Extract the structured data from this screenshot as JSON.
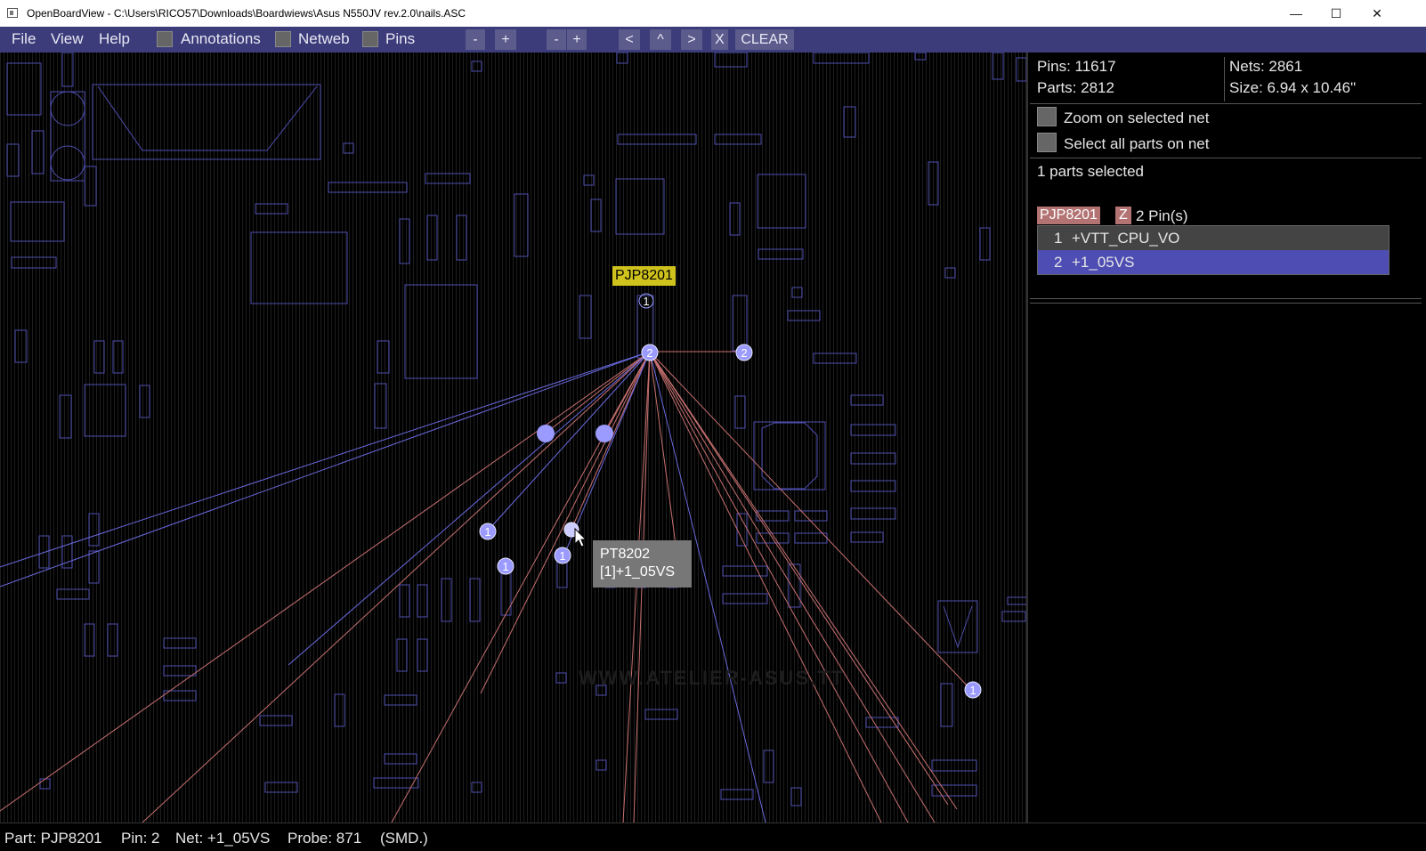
{
  "window": {
    "title": "OpenBoardView - C:\\Users\\RICO57\\Downloads\\Boardwiews\\Asus N550JV rev.2.0\\nails.ASC",
    "minimize": "—",
    "maximize": "☐",
    "close": "✕"
  },
  "menu": {
    "file": "File",
    "view": "View",
    "help": "Help",
    "annotations": "Annotations",
    "netweb": "Netweb",
    "pins": "Pins"
  },
  "toolbar": {
    "zoom_out_1": "-",
    "zoom_in_1": "+",
    "zoom_out_2": "-",
    "zoom_in_2": "+",
    "prev": "<",
    "up": "^",
    "next": ">",
    "close_x": "X",
    "clear": "CLEAR"
  },
  "board": {
    "part_label": "PJP8201",
    "tooltip_part": "PT8202",
    "tooltip_net": "[1]+1_05VS",
    "watermark": "WWW.ATELIER-ASUS.TT",
    "pin_labels": [
      "1",
      "2",
      "2",
      "1",
      "1",
      "1",
      "1"
    ]
  },
  "panel": {
    "pins": "Pins: 11617",
    "parts": "Parts: 2812",
    "nets": "Nets: 2861",
    "size": "Size: 6.94 x 10.46\"",
    "zoom_on_net": "Zoom on selected net",
    "select_all_parts": "Select all parts on net",
    "parts_selected": "1 parts selected",
    "selected_part": "PJP8201",
    "z_badge": "Z",
    "pin_count": "2 Pin(s)",
    "pin_rows": [
      {
        "num": "1",
        "net": "+VTT_CPU_VO"
      },
      {
        "num": "2",
        "net": "+1_05VS"
      }
    ]
  },
  "status": {
    "part": "Part: PJP8201",
    "pin": "Pin: 2",
    "net": "Net: +1_05VS",
    "probe": "Probe: 871",
    "type": "(SMD.)"
  },
  "colors": {
    "menubar": "#3c3c7a",
    "outline": "#4e4eb0",
    "net_red": "#c87070",
    "net_blue": "#6a6ae0",
    "pin_circle": "#9a9aff",
    "part_label_bg": "#cfc21c",
    "selected_row": "#4d4db3"
  }
}
